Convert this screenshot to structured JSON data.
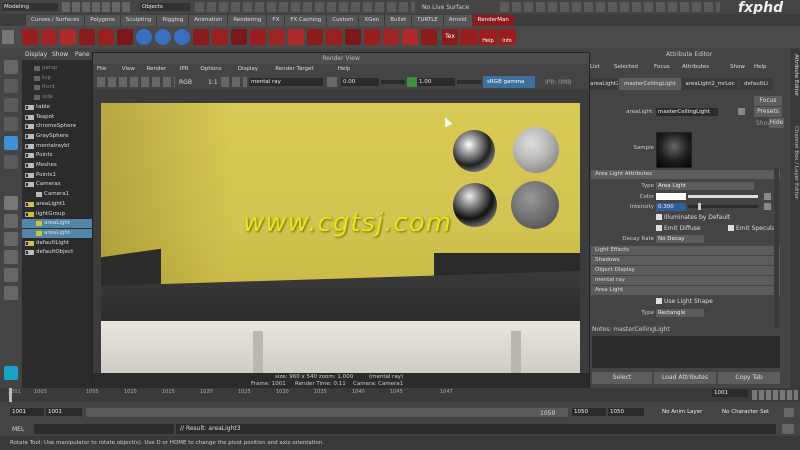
{
  "top": {
    "mode": "Modeling",
    "objects": "Objects",
    "live": "No Live Surface",
    "brand": "fxphd"
  },
  "shelf_tabs": [
    "Curves / Surfaces",
    "Polygons",
    "Sculpting",
    "Rigging",
    "Animation",
    "Rendering",
    "FX",
    "FX Caching",
    "Custom",
    "XGen",
    "Bullet",
    "TURTLE",
    "Arnold",
    "RenderMan"
  ],
  "shelf_icons": {
    "tex": "Tex",
    "help": "Help",
    "info": "Info"
  },
  "outliner": {
    "menu": [
      "Display",
      "Show",
      "Pane"
    ],
    "items": [
      "persp",
      "top",
      "front",
      "side",
      "table",
      "Teapot",
      "chromeSphere",
      "GraySphere",
      "mentalraybl",
      "Points",
      "Meshes",
      "Points1",
      "Cameras",
      "Camera1",
      "areaLight1",
      "lightGroup",
      "areaLight",
      "areaLight",
      "defaultLight",
      "defaultObject"
    ]
  },
  "render_view": {
    "title": "Render View",
    "menu": [
      "File",
      "View",
      "Render",
      "IPR",
      "Options",
      "Display",
      "Render Target",
      "Help"
    ],
    "renderer": "mental ray",
    "rgb": "RGB",
    "ratio": "1:1",
    "exposure": "0.00",
    "gamma": "1.00",
    "colorspace": "sRGB gamma",
    "ipr": "IPR: 0MB",
    "footer_size": "size: 960 x 540 zoom: 1.000",
    "footer_renderer": "(mental ray)",
    "footer_frame": "Frame: 1001",
    "footer_time": "Render Time: 0:11",
    "footer_camera": "Camera: Camera1",
    "watermark": "www.cgtsj.com"
  },
  "attr": {
    "title": "Attribute Editor",
    "menu": [
      "List",
      "Selected",
      "Focus",
      "Attributes",
      "Show",
      "Help"
    ],
    "tabs": [
      "areaLight2",
      "masterCellingLight",
      "areaLight2_mrLoc",
      "defaultLi"
    ],
    "node_label": "areaLight:",
    "node_value": "masterCellingLight",
    "focus": "Focus",
    "presets": "Presets",
    "show": "Show",
    "hide": "Hide",
    "sample": "Sample",
    "section_area": "Area Light Attributes",
    "type_label": "Type",
    "type_value": "Area Light",
    "color_label": "Color",
    "intensity_label": "Intensity",
    "intensity_value": "0.300",
    "illum": "Illuminates by Default",
    "emit_diffuse": "Emit Diffuse",
    "emit_specular": "Emit Specular",
    "decay_label": "Decay Rate",
    "decay_value": "No Decay",
    "sections": [
      "Light Effects",
      "Shadows",
      "Object Display",
      "mental ray",
      "Area Light"
    ],
    "use_shape": "Use Light Shape",
    "shape_type_label": "Type",
    "shape_type_value": "Rectangle",
    "notes": "Notes: masterCellingLight",
    "select": "Select",
    "load": "Load Attributes",
    "copy": "Copy Tab",
    "side_tabs": [
      "Attribute Editor",
      "Channel Box / Layer Editor"
    ]
  },
  "timeline": {
    "ticks": [
      "1001",
      "1003",
      "1005",
      "1010",
      "1015",
      "1020",
      "1025",
      "1030",
      "1035",
      "1040",
      "1045",
      "1047"
    ],
    "current": "1001",
    "start": "1001",
    "range_start": "1001",
    "range_end": "1050",
    "end1": "1050",
    "end2": "1050",
    "anim_layer": "No Anim Layer",
    "char_set": "No Character Set"
  },
  "cmd": {
    "label": "MEL",
    "result": "// Result: areaLight3"
  },
  "help": "Rotate Tool: Use manipulator to rotate object(s). Use D or HOME to change the pivot position and axis orientation."
}
